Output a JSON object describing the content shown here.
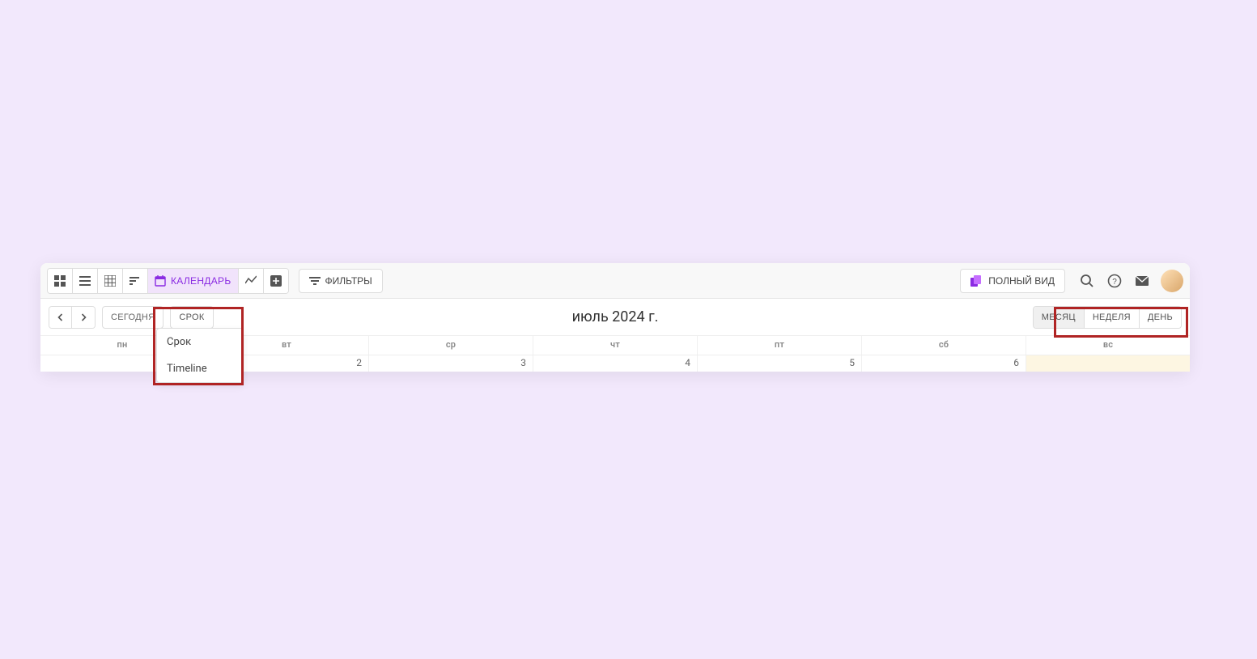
{
  "toolbar": {
    "calendar_label": "КАЛЕНДАРЬ",
    "filters_label": "ФИЛЬТРЫ",
    "fullview_label": "ПОЛНЫЙ ВИД"
  },
  "subbar": {
    "today_label": "СЕГОДНЯ",
    "srok_label": "СРОК",
    "srok_options": [
      "Срок",
      "Timeline"
    ],
    "title": "июль 2024 г.",
    "range": {
      "month": "МЕСЯЦ",
      "week": "НЕДЕЛЯ",
      "day": "ДЕНЬ"
    }
  },
  "calendar": {
    "day_headers": [
      "пн",
      "вт",
      "ср",
      "чт",
      "пт",
      "сб",
      "вс"
    ],
    "dates": [
      "",
      "2",
      "3",
      "4",
      "5",
      "6",
      ""
    ]
  }
}
